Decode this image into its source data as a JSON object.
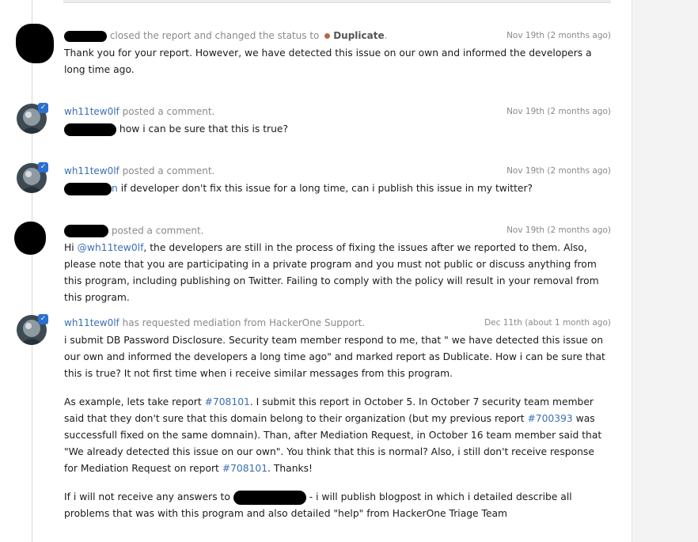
{
  "activity": [
    {
      "action": "closed the report and changed the status to",
      "status": "Duplicate",
      "status_suffix": ".",
      "time": "Nov 19th (2 months ago)",
      "body": "Thank you for your report. However, we have detected this issue on our own and informed the developers a long time ago."
    },
    {
      "user": "wh11tew0lf",
      "action": "posted a comment.",
      "time": "Nov 19th (2 months ago)",
      "body": "how i can be sure that this is true?"
    },
    {
      "user": "wh11tew0lf",
      "action": "posted a comment.",
      "time": "Nov 19th (2 months ago)",
      "body_link": "n",
      "body": "if developer don't fix this issue for a long time, can i publish this issue in my twitter?"
    },
    {
      "action": "posted a comment.",
      "time": "Nov 19th (2 months ago)",
      "body_pre": "Hi",
      "mention": "@wh11tew0lf",
      "body_post": ", the developers are still in the process of fixing the issues after we reported to them. Also, please note that you are participating in a private program and you must not public or discuss anything from this program, including publishing on Twitter. Failing to comply with the policy will result in your removal from this program."
    },
    {
      "user": "wh11tew0lf",
      "action": "has requested mediation from HackerOne Support.",
      "time": "Dec 11th (about 1 month ago)",
      "p1": "i submit DB Password Disclosure. Security team member respond to me, that \" we have detected this issue on our own and informed the developers a long time ago\" and marked report as Dublicate. How i can be sure that this is true? It not first time when i receive similar messages from this program.",
      "p2_a": "As example, lets take report",
      "p2_link1": "#708101",
      "p2_b": ". I submit this report in October 5. In October 7 security team member said that they don't sure that this domain belong to their organization (but my previous report",
      "p2_link2": "#700393",
      "p2_c": "was successfull fixed on the same domnain). Than, after Mediation Request, in October 16 team member said that \"We already detected this issue on our own\". You think that this is normal? Also, i still don't receive response for Mediation Request on report",
      "p2_link3": "#708101",
      "p2_d": ". Thanks!",
      "p3_a": "If i will not receive any answers to",
      "p3_b": "- i will publish blogpost in which i detailed describe all problems that was with this program and also detailed \"help\" from HackerOne Triage Team"
    }
  ],
  "colors": {
    "link": "#3b6fb6",
    "muted": "#8a8a8a",
    "duplicate_dot": "#b06a46",
    "verified_badge": "#2b6fcf"
  }
}
